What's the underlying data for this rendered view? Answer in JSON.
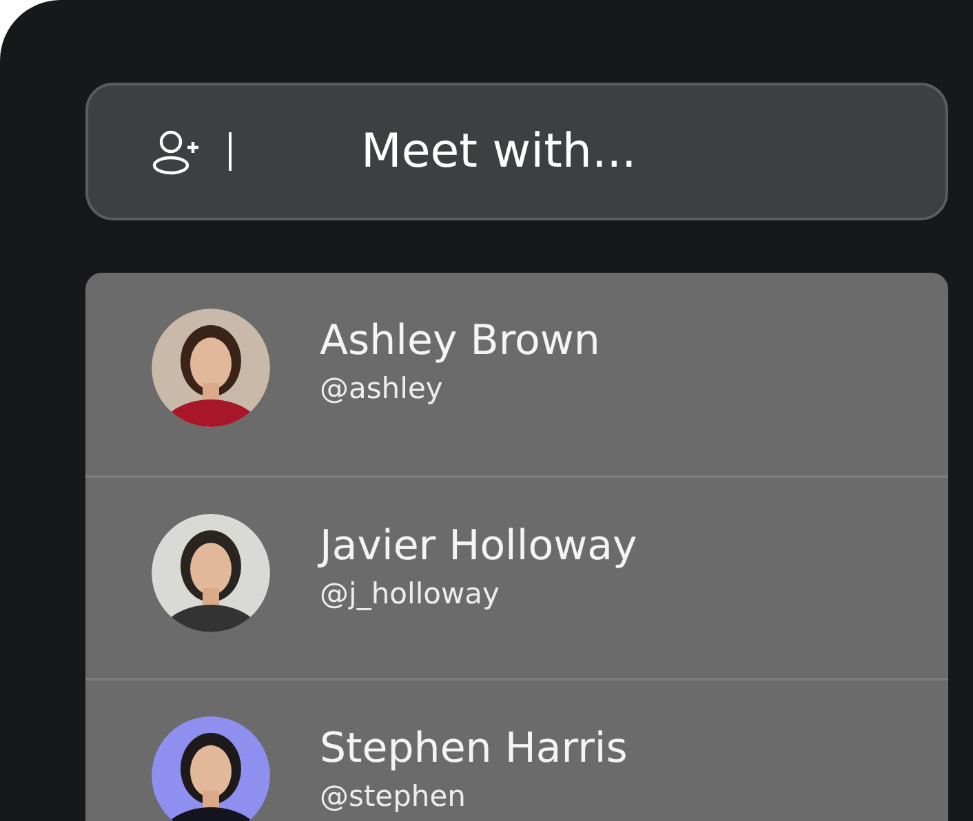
{
  "search": {
    "placeholder": "Meet with..."
  },
  "contacts": [
    {
      "name": "Ashley Brown",
      "handle": "@ashley",
      "kind": "picture"
    },
    {
      "name": "Javier Holloway",
      "handle": "@j_holloway",
      "kind": "picture"
    },
    {
      "name": "Stephen Harris",
      "handle": "@stephen",
      "kind": "picture"
    }
  ]
}
